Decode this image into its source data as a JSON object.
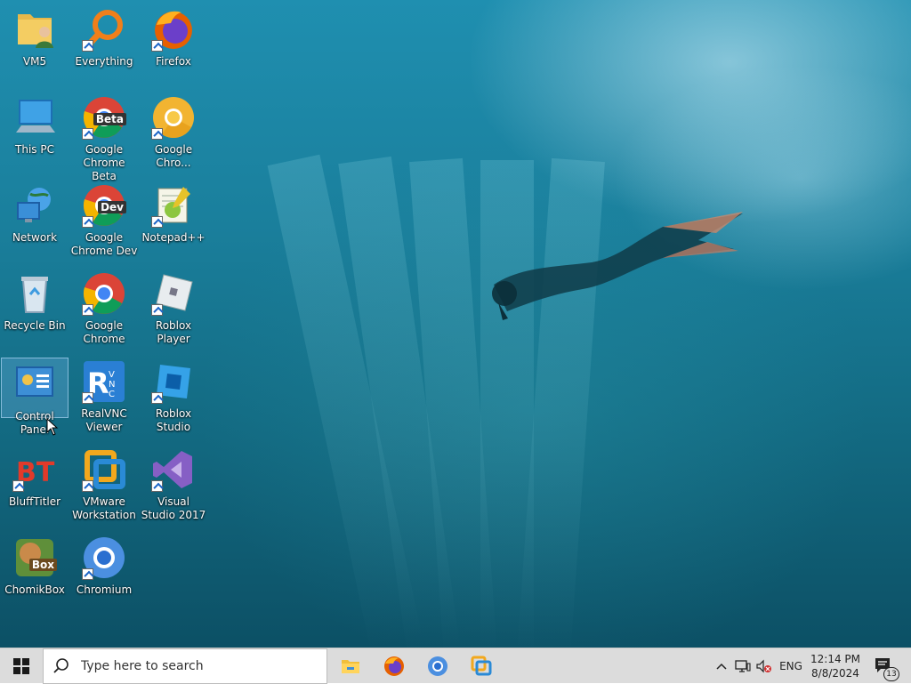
{
  "desktop": {
    "icons": [
      {
        "label": "VM5"
      },
      {
        "label": "Everything"
      },
      {
        "label": "Firefox"
      },
      {
        "label": "This PC"
      },
      {
        "label": "Google Chrome Beta",
        "badge": "Beta"
      },
      {
        "label": "Google Chro..."
      },
      {
        "label": "Network"
      },
      {
        "label": "Google Chrome Dev",
        "badge": "Dev"
      },
      {
        "label": "Notepad++"
      },
      {
        "label": "Recycle Bin"
      },
      {
        "label": "Google Chrome"
      },
      {
        "label": "Roblox Player"
      },
      {
        "label": "Control Panel",
        "selected": true
      },
      {
        "label": "RealVNC Viewer"
      },
      {
        "label": "Roblox Studio"
      },
      {
        "label": "BluffTitler"
      },
      {
        "label": "VMware Workstation"
      },
      {
        "label": "Visual Studio 2017"
      },
      {
        "label": "ChomikBox",
        "badge": "Box"
      },
      {
        "label": "Chromium"
      }
    ]
  },
  "taskbar": {
    "search_placeholder": "Type here to search",
    "pinned": [
      "file-explorer-icon",
      "firefox-icon",
      "chromium-icon",
      "vmware-icon"
    ],
    "tray": {
      "language": "ENG",
      "time": "12:14 PM",
      "date": "8/8/2024",
      "notification_count": "13"
    }
  },
  "colors": {
    "accent": "#1d66c7",
    "taskbar_bg": "#dcdcdc",
    "water": "#1a7f9c"
  }
}
